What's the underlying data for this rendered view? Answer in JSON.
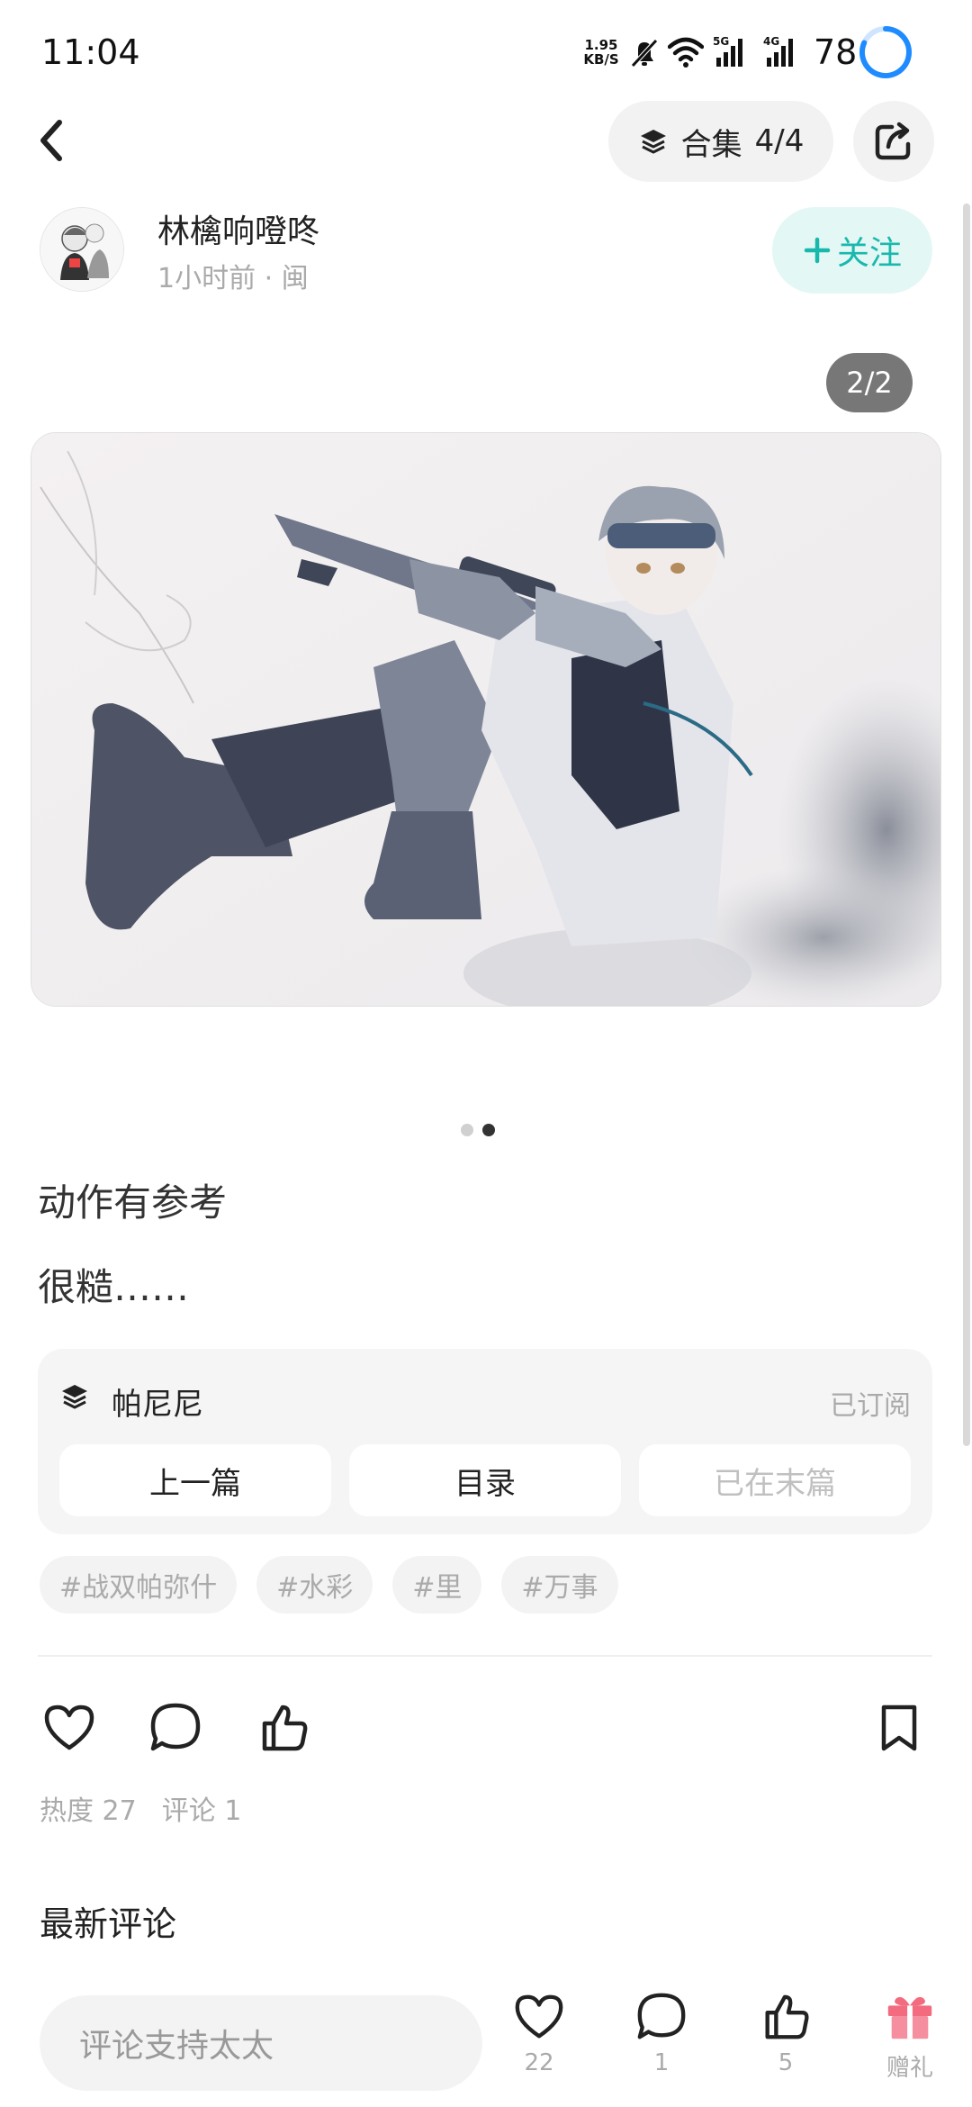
{
  "status_bar": {
    "time": "11:04",
    "net_speed_value": "1.95",
    "net_speed_unit": "KB/S",
    "battery": "78",
    "icons": [
      "mute-bell-icon",
      "wifi-icon",
      "signal-5g-icon",
      "signal-4g-icon",
      "battery-ring-icon"
    ]
  },
  "nav": {
    "collection_label": "合集",
    "collection_progress": "4/4"
  },
  "author": {
    "name": "林檎响噔咚",
    "meta": "1小时前 · 闽",
    "follow_label": "关注"
  },
  "image": {
    "page_indicator": "2/2",
    "total": 2,
    "current": 2
  },
  "post": {
    "line1": "动作有参考",
    "line2": "很糙……"
  },
  "collection_card": {
    "name": "帕尼尼",
    "status": "已订阅",
    "prev_label": "上一篇",
    "toc_label": "目录",
    "last_label": "已在末篇"
  },
  "tags": [
    "#战双帕弥什",
    "#水彩",
    "#里",
    "#万事"
  ],
  "stats": {
    "heat": "热度 27",
    "comments": "评论 1"
  },
  "latest_comments_title": "最新评论",
  "bottom_bar": {
    "comment_placeholder": "评论支持太太",
    "like_count": "22",
    "comment_count": "1",
    "recommend_count": "5",
    "gift_label": "赠礼"
  },
  "colors": {
    "accent": "#19b8ac",
    "follow_bg": "#e3f7f5",
    "gift": "#f26b7f"
  }
}
